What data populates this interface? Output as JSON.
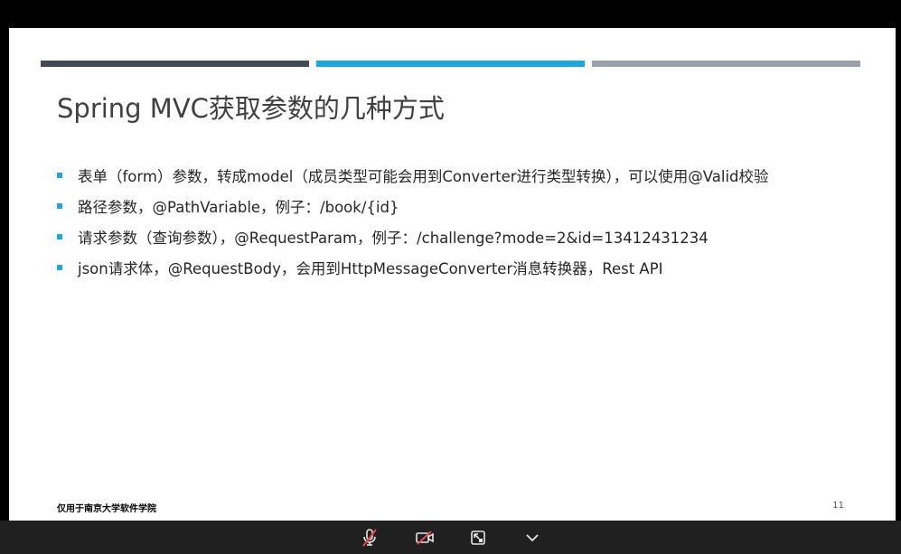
{
  "slide": {
    "title": "Spring MVC获取参数的几种方式",
    "stripe_colors": [
      "#434a50",
      "#1ea7df",
      "#9ba2a7"
    ],
    "bullet_color": "#1ea7df",
    "bullets": [
      {
        "text": "表单（form）参数，转成model（成员类型可能会用到Converter进行类型转换），可以使用@Valid校验"
      },
      {
        "text": "路径参数，@PathVariable，例子：/book/{id}"
      },
      {
        "text": "请求参数（查询参数），@RequestParam，例子：/challenge?mode=2&id=13412431234"
      },
      {
        "text": "json请求体，@RequestBody，会用到HttpMessageConverter消息转换器，Rest API"
      }
    ],
    "footer_left": "仅用于南京大学软件学院",
    "page_number": "11"
  },
  "controls": {
    "mic_icon": "microphone-muted-icon",
    "camera_icon": "camera-off-icon",
    "share_icon": "exit-fullscreen-icon",
    "more_icon": "chevron-down-icon",
    "muted_color": "#e5484d",
    "icon_color": "#e6e6e6"
  }
}
